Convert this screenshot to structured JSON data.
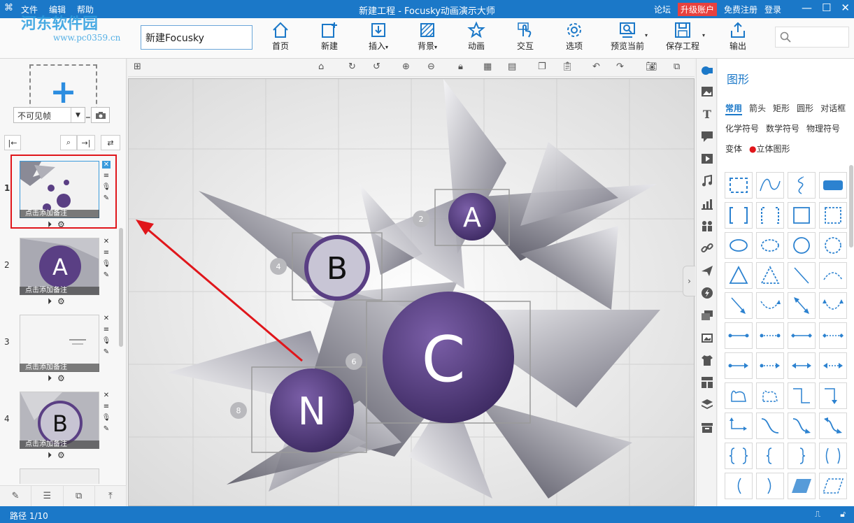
{
  "titlebar": {
    "menu": [
      "文件",
      "编辑",
      "帮助"
    ],
    "title": "新建工程 - Focusky动画演示大师",
    "links": {
      "forum": "论坛",
      "upgrade": "升级账户",
      "register": "免费注册",
      "login": "登录"
    },
    "watermark": "河东软件园",
    "watermark_url": "www.pc0359.cn"
  },
  "toolbar": {
    "project_name": "新建Focusky",
    "items": {
      "home": "首页",
      "new": "新建",
      "insert": "插入",
      "background": "背景",
      "animation": "动画",
      "interact": "交互",
      "options": "选项",
      "preview": "预览当前",
      "save": "保存工程",
      "export": "输出"
    },
    "search_placeholder": ""
  },
  "left": {
    "add_symbol": "+",
    "frame_select": "不可见帧",
    "slides": [
      {
        "num": "1",
        "note": "点击添加备注"
      },
      {
        "num": "2",
        "note": "点击添加备注"
      },
      {
        "num": "3",
        "note": "点击添加备注"
      },
      {
        "num": "4",
        "note": "点击添加备注"
      }
    ]
  },
  "canvas": {
    "bubbles": {
      "a": "A",
      "b": "B",
      "c": "C",
      "n": "N"
    },
    "path_numbers": {
      "p2": "2",
      "p4": "4",
      "p6": "6",
      "p8": "8"
    }
  },
  "right_panel": {
    "title": "图形",
    "cat_row1": [
      "常用",
      "箭头",
      "矩形",
      "圆形",
      "对话框"
    ],
    "cat_row2": [
      "化学符号",
      "数学符号",
      "物理符号"
    ],
    "cat_row3": [
      "变体",
      "立体图形"
    ]
  },
  "status": {
    "path": "路径 1/10"
  },
  "colors": {
    "accent": "#1b78c8",
    "upgrade": "#e8413f",
    "highlight": "#e0161b",
    "bubble": "#5a3f84"
  }
}
